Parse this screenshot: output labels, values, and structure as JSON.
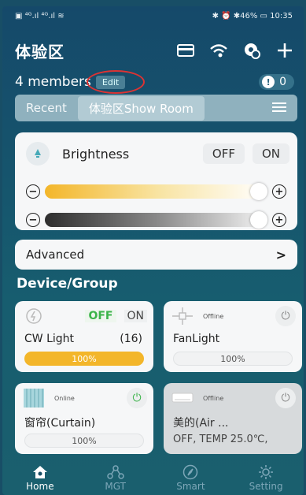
{
  "statusbar": {
    "left": "▣ ⁴ᴳ.ıl ⁴ᴳ.ıl ≋",
    "right": "✱ ⏰ ✱46% ▭ 10:35"
  },
  "header": {
    "title": "体验区",
    "icons": [
      "card-icon",
      "wifi-icon",
      "pin-icon",
      "plus-icon"
    ]
  },
  "members": {
    "text": "4 members",
    "edit_label": "Edit",
    "alert_count": "0"
  },
  "recent": {
    "label": "Recent",
    "room": "体验区Show Room"
  },
  "brightness": {
    "label": "Brightness",
    "off_label": "OFF",
    "on_label": "ON",
    "warm_level": 1.0,
    "cool_level": 1.0
  },
  "advanced": {
    "label": "Advanced",
    "chevron": ">"
  },
  "section_title": "Device/Group",
  "tiles": [
    {
      "name": "CW Light",
      "count": "(16)",
      "off_label": "OFF",
      "on_label": "ON",
      "bar": "100%"
    },
    {
      "name": "FanLight",
      "tag": "Offline",
      "bar": "100%"
    },
    {
      "name": "窗帘(Curtain)",
      "tag": "Online",
      "bar": "100%"
    },
    {
      "name": "美的(Air ...",
      "tag": "Offline",
      "status": "OFF, TEMP 25.0℃,"
    }
  ],
  "nav": [
    {
      "label": "Home",
      "icon": "home-icon"
    },
    {
      "label": "MGT",
      "icon": "network-icon"
    },
    {
      "label": "Smart",
      "icon": "compass-icon"
    },
    {
      "label": "Setting",
      "icon": "gear-icon"
    }
  ],
  "colors": {
    "background": "#184e66",
    "accent": "#f3b62a",
    "power_on": "#3cb44a",
    "edit_highlight": "#dd3333"
  }
}
